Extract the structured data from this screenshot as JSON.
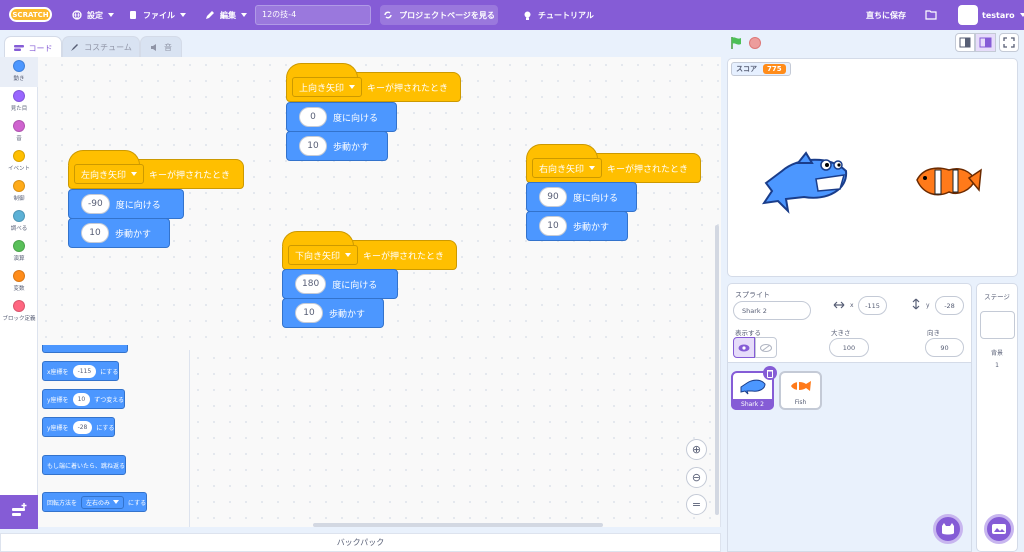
{
  "menubar": {
    "logo": "SCRATCH",
    "settings": "設定",
    "file": "ファイル",
    "edit": "編集",
    "project_title": "12の技-4",
    "see_project_page": "プロジェクトページを見る",
    "tutorials": "チュートリアル",
    "save_now": "直ちに保存",
    "username": "testaro",
    "bg_color": "#855cd6"
  },
  "tabs": {
    "code": "コード",
    "costumes": "コスチューム",
    "sounds": "音"
  },
  "categories": [
    {
      "label": "動き",
      "color": "#4c97ff"
    },
    {
      "label": "見た目",
      "color": "#9966ff"
    },
    {
      "label": "音",
      "color": "#cf63cf"
    },
    {
      "label": "イベント",
      "color": "#ffbf00"
    },
    {
      "label": "制御",
      "color": "#ffab19"
    },
    {
      "label": "調べる",
      "color": "#5cb1d6"
    },
    {
      "label": "演算",
      "color": "#59c059"
    },
    {
      "label": "変数",
      "color": "#ff8c1a"
    },
    {
      "label": "ブロック定義",
      "color": "#ff6680"
    }
  ],
  "palette": {
    "set_x": {
      "pre": "x座標を",
      "value": "-115",
      "post": "にする"
    },
    "change_y": {
      "pre": "y座標を",
      "value": "10",
      "post": "ずつ変える"
    },
    "set_y": {
      "pre": "y座標を",
      "value": "-28",
      "post": "にする"
    },
    "bounce": "もし端に着いたら、跳ね返る",
    "rotation": {
      "pre": "回転方法を",
      "value": "左右のみ",
      "post": "にする"
    }
  },
  "scripts": {
    "hat_suffix": "キーが押されたとき",
    "point_label": "度に向ける",
    "move_label": "歩動かす",
    "up": {
      "key": "上向き矢印",
      "direction": "0",
      "steps": "10"
    },
    "left": {
      "key": "左向き矢印",
      "direction": "-90",
      "steps": "10"
    },
    "down": {
      "key": "下向き矢印",
      "direction": "180",
      "steps": "10"
    },
    "right": {
      "key": "右向き矢印",
      "direction": "90",
      "steps": "10"
    }
  },
  "backpack": "バックパック",
  "stage": {
    "score_label": "スコア",
    "score_value": "775"
  },
  "sprite_info": {
    "sprite_label": "スプライト",
    "sprite_name": "Shark 2",
    "x_label": "x",
    "x": "-115",
    "y_label": "y",
    "y": "-28",
    "show_label": "表示する",
    "size_label": "大きさ",
    "size": "100",
    "direction_label": "向き",
    "direction": "90"
  },
  "sprites": [
    {
      "name": "Shark 2",
      "selected": true
    },
    {
      "name": "Fish",
      "selected": false
    }
  ],
  "stage_side": {
    "title": "ステージ",
    "backdrops_label": "背景",
    "backdrops_count": "1"
  }
}
